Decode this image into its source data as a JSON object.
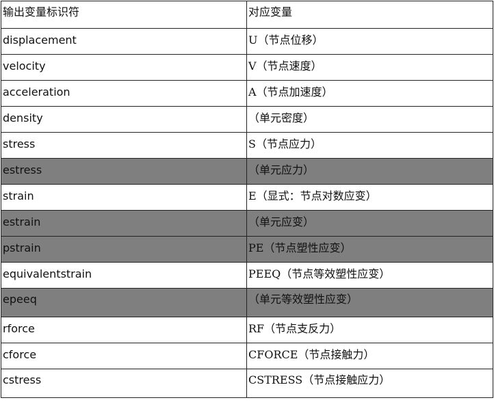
{
  "table": {
    "header": {
      "col1": "输出变量标识符",
      "col2": "对应变量"
    },
    "rows": [
      {
        "id": "displacement",
        "desc": "U（节点位移）",
        "shaded": false
      },
      {
        "id": "velocity",
        "desc": "V（节点速度）",
        "shaded": false
      },
      {
        "id": "acceleration",
        "desc": "A（节点加速度）",
        "shaded": false
      },
      {
        "id": "density",
        "desc": "（单元密度）",
        "shaded": false
      },
      {
        "id": "stress",
        "desc": "S（节点应力）",
        "shaded": false
      },
      {
        "id": "estress",
        "desc": "（单元应力）",
        "shaded": true
      },
      {
        "id": "strain",
        "desc": "E（显式：节点对数应变）",
        "shaded": false
      },
      {
        "id": "estrain",
        "desc": "（单元应变）",
        "shaded": true
      },
      {
        "id": "pstrain",
        "desc": "PE（节点塑性应变）",
        "shaded": true
      },
      {
        "id": "equivalentstrain",
        "desc": "PEEQ（节点等效塑性应变）",
        "shaded": false
      },
      {
        "id": "epeeq",
        "desc": "（单元等效塑性应变）",
        "shaded": true
      },
      {
        "id": "rforce",
        "desc": "RF（节点支反力）",
        "shaded": false
      },
      {
        "id": "cforce",
        "desc": "CFORCE（节点接触力）",
        "shaded": false
      },
      {
        "id": "cstress",
        "desc": "CSTRESS（节点接触应力）",
        "shaded": false
      }
    ],
    "shade_color": "#7f7f7f"
  }
}
